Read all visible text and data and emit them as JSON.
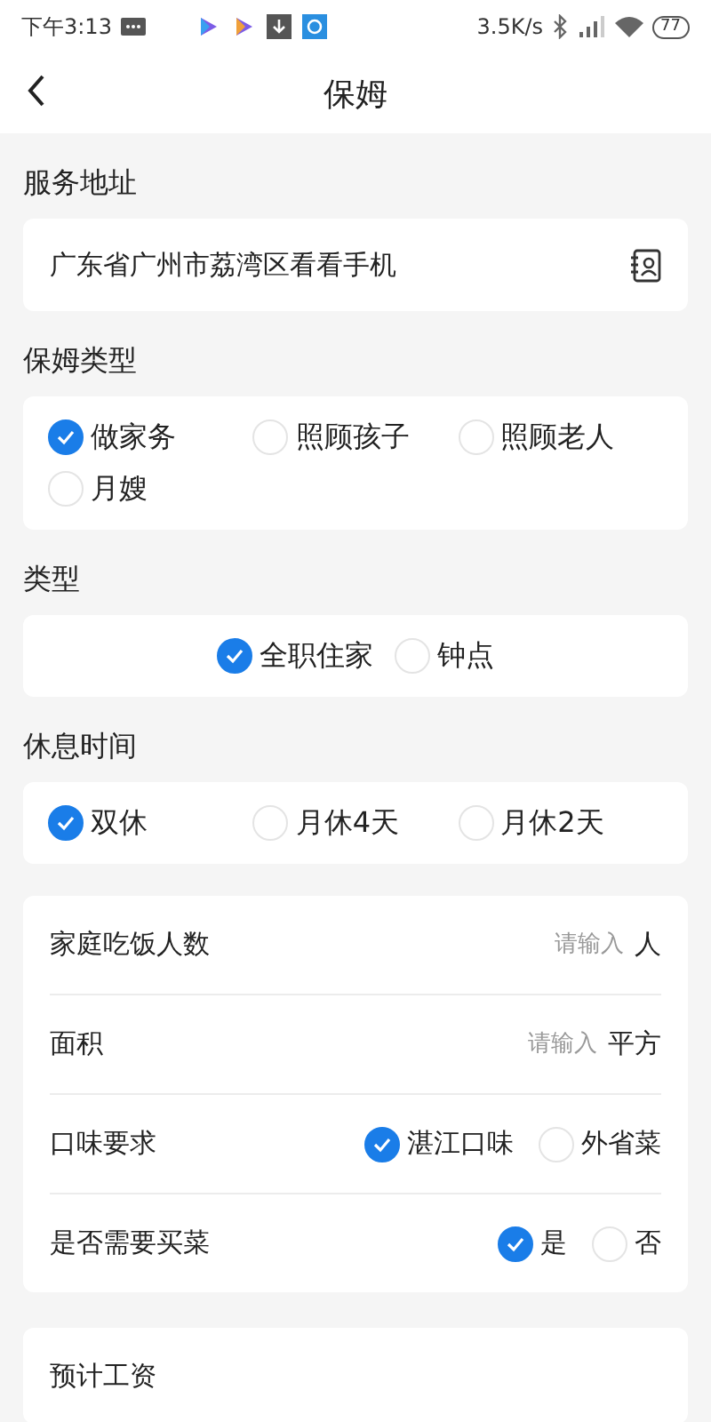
{
  "status_bar": {
    "time": "下午3:13",
    "speed": "3.5K/s",
    "battery": "77"
  },
  "header": {
    "title": "保姆"
  },
  "address": {
    "label": "服务地址",
    "value": "广东省广州市荔湾区看看手机"
  },
  "groups": [
    {
      "label": "保姆类型",
      "kind": "grid",
      "options": [
        {
          "label": "做家务",
          "selected": true
        },
        {
          "label": "照顾孩子",
          "selected": false
        },
        {
          "label": "照顾老人",
          "selected": false
        },
        {
          "label": "月嫂",
          "selected": false
        }
      ]
    },
    {
      "label": "类型",
      "kind": "center",
      "options": [
        {
          "label": "全职住家",
          "selected": true
        },
        {
          "label": "钟点",
          "selected": false
        }
      ]
    },
    {
      "label": "休息时间",
      "kind": "grid",
      "options": [
        {
          "label": "双休",
          "selected": true
        },
        {
          "label": "月休4天",
          "selected": false
        },
        {
          "label": "月休2天",
          "selected": false
        }
      ]
    }
  ],
  "form": [
    {
      "kind": "input",
      "label": "家庭吃饭人数",
      "placeholder": "请输入",
      "unit": "人"
    },
    {
      "kind": "input",
      "label": "面积",
      "placeholder": "请输入",
      "unit": "平方"
    },
    {
      "kind": "choice",
      "label": "口味要求",
      "options": [
        {
          "label": "湛江口味",
          "selected": true
        },
        {
          "label": "外省菜",
          "selected": false
        }
      ]
    },
    {
      "kind": "choice",
      "label": "是否需要买菜",
      "options": [
        {
          "label": "是",
          "selected": true
        },
        {
          "label": "否",
          "selected": false
        }
      ]
    }
  ],
  "salary": {
    "label": "预计工资"
  }
}
